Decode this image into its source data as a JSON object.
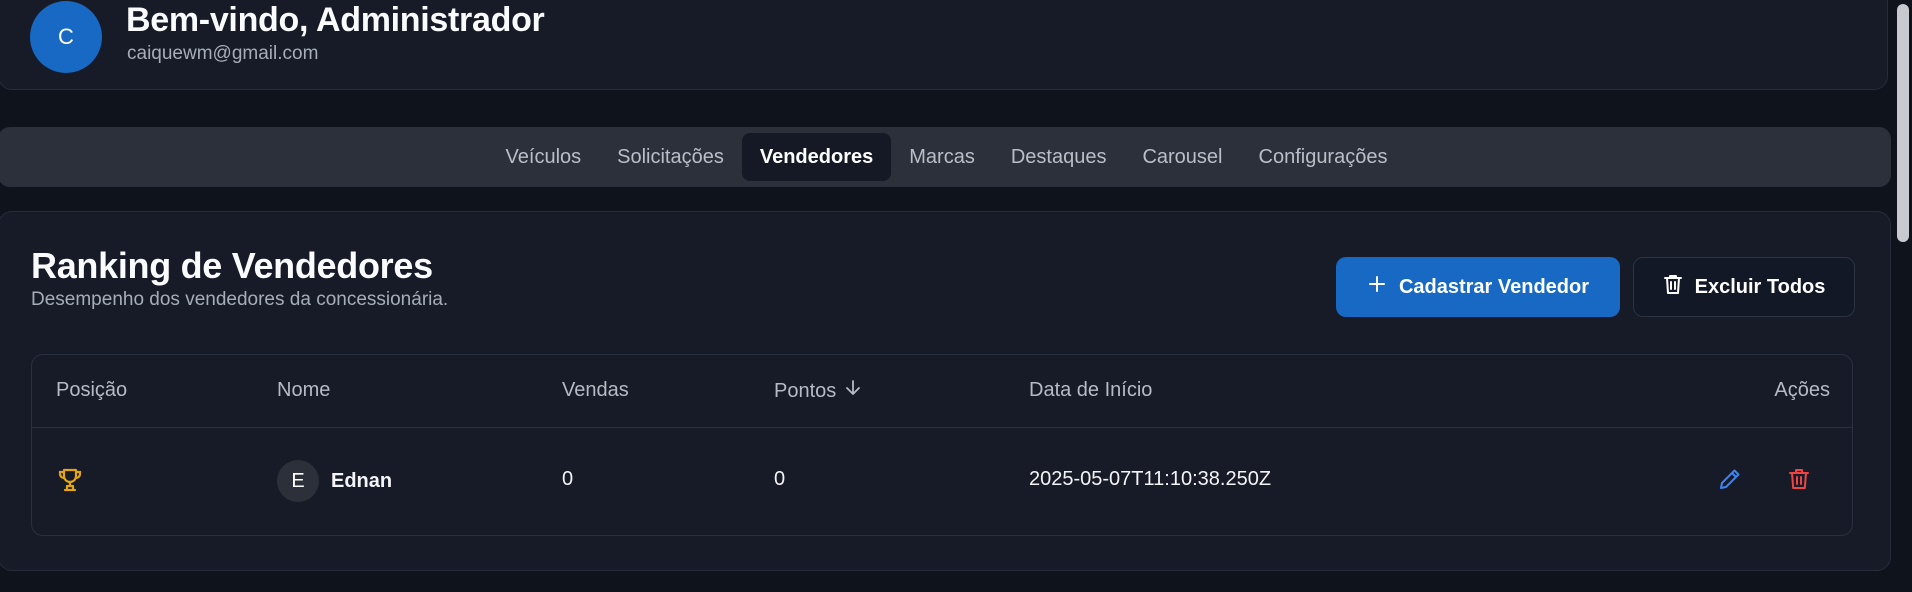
{
  "header": {
    "avatar_initial": "C",
    "welcome": "Bem-vindo, Administrador",
    "email": "caiquewm@gmail.com"
  },
  "tabs": [
    {
      "label": "Veículos",
      "active": false
    },
    {
      "label": "Solicitações",
      "active": false
    },
    {
      "label": "Vendedores",
      "active": true
    },
    {
      "label": "Marcas",
      "active": false
    },
    {
      "label": "Destaques",
      "active": false
    },
    {
      "label": "Carousel",
      "active": false
    },
    {
      "label": "Configurações",
      "active": false
    }
  ],
  "section": {
    "title": "Ranking de Vendedores",
    "subtitle": "Desempenho dos vendedores da concessionária.",
    "add_button": "Cadastrar Vendedor",
    "delete_all_button": "Excluir Todos"
  },
  "table": {
    "columns": {
      "position": "Posição",
      "name": "Nome",
      "sales": "Vendas",
      "points": "Pontos",
      "start_date": "Data de Início",
      "actions": "Ações"
    },
    "sorted_by": "points",
    "sort_direction": "descending",
    "rows": [
      {
        "position_icon": "trophy-icon",
        "avatar_initial": "E",
        "name": "Ednan",
        "sales": "0",
        "points": "0",
        "start_date": "2025-05-07T11:10:38.250Z"
      }
    ]
  },
  "colors": {
    "accent": "#1769c4",
    "trophy": "#e3a514",
    "edit": "#3b82f6",
    "delete": "#ef4444",
    "background": "#0f131b",
    "card": "#161b27"
  }
}
